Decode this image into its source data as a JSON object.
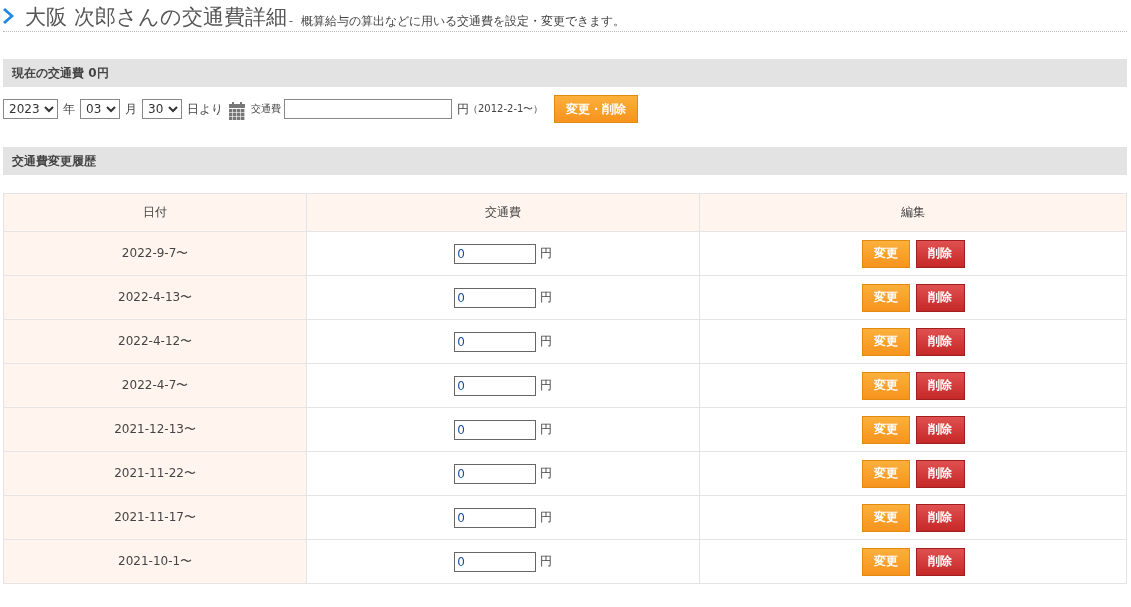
{
  "page": {
    "title": "大阪 次郎さんの交通費詳細",
    "separator": "-",
    "description": "概算給与の算出などに用いる交通費を設定・変更できます。"
  },
  "current_section": {
    "heading": "現在の交通費 0円"
  },
  "form": {
    "year": "2023",
    "year_unit": "年",
    "month": "03",
    "month_unit": "月",
    "day": "30",
    "day_unit": "日より",
    "fee_label": "交通費",
    "unit": "円",
    "range_note": "（2012-2-1〜）",
    "submit": "変更・削除"
  },
  "history_section": {
    "heading": "交通費変更履歴"
  },
  "table": {
    "columns": [
      "日付",
      "交通費",
      "編集"
    ],
    "rows": [
      {
        "date": "2022-9-7〜",
        "amount": "0",
        "unit": "円",
        "edit": "変更",
        "delete": "削除"
      },
      {
        "date": "2022-4-13〜",
        "amount": "0",
        "unit": "円",
        "edit": "変更",
        "delete": "削除"
      },
      {
        "date": "2022-4-12〜",
        "amount": "0",
        "unit": "円",
        "edit": "変更",
        "delete": "削除"
      },
      {
        "date": "2022-4-7〜",
        "amount": "0",
        "unit": "円",
        "edit": "変更",
        "delete": "削除"
      },
      {
        "date": "2021-12-13〜",
        "amount": "0",
        "unit": "円",
        "edit": "変更",
        "delete": "削除"
      },
      {
        "date": "2021-11-22〜",
        "amount": "0",
        "unit": "円",
        "edit": "変更",
        "delete": "削除"
      },
      {
        "date": "2021-11-17〜",
        "amount": "0",
        "unit": "円",
        "edit": "変更",
        "delete": "削除"
      },
      {
        "date": "2021-10-1〜",
        "amount": "0",
        "unit": "円",
        "edit": "変更",
        "delete": "削除"
      }
    ]
  }
}
